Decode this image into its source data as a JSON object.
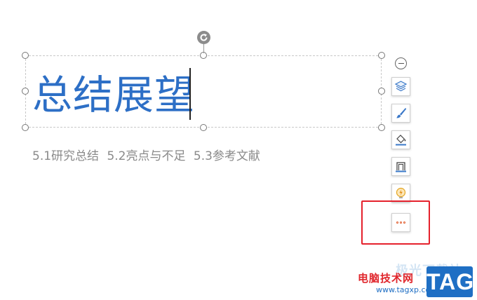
{
  "slide": {
    "title": "总结展望",
    "subtitle": "5.1研究总结 5.2亮点与不足 5.3参考文献"
  },
  "toolbar": {
    "items": [
      {
        "name": "layers-icon"
      },
      {
        "name": "brush-icon"
      },
      {
        "name": "fill-icon"
      },
      {
        "name": "outline-icon"
      },
      {
        "name": "effects-icon"
      },
      {
        "name": "more-options-icon"
      }
    ]
  },
  "colors": {
    "title": "#2d6fc6",
    "subtitle": "#8a8a8a",
    "highlight": "#e5212c",
    "watermark_red": "#e0262c",
    "watermark_blue": "#1f6fc4"
  },
  "watermark": {
    "faded": "极光下载站",
    "site": "电脑技术网",
    "url": "www.tagxp.com",
    "tag": "TAG"
  }
}
